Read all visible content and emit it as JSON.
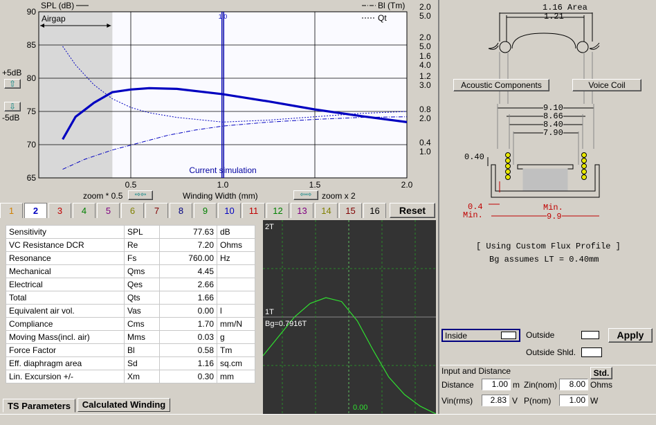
{
  "colors": {
    "accent": "#0000c0",
    "bg": "#d4d0c8",
    "graph_bg": "#333333",
    "green": "#00c000",
    "red": "#c00000"
  },
  "chart_data": {
    "type": "line",
    "title": "",
    "xlabel": "Winding Width (mm)",
    "ylabel": "SPL (dB)",
    "xlim": [
      0.0,
      2.0
    ],
    "ylim": [
      65,
      90
    ],
    "x_ticks": [
      "0.5",
      "1.0",
      "1.5",
      "2.0"
    ],
    "y_ticks": [
      "90",
      "85",
      "80",
      "75",
      "70",
      "65"
    ],
    "right_axis_bl": [
      "2.0",
      "1.6",
      "1.2",
      "0.8",
      "0.4"
    ],
    "right_axis_qt": [
      "5.0",
      "4.0",
      "3.0",
      "2.0",
      "1.0"
    ],
    "legend": {
      "spl": "SPL (dB)",
      "bl": "Bl (Tm)",
      "qt": "Qt"
    },
    "series": [
      {
        "name": "SPL (dB)",
        "x": [
          0.13,
          0.2,
          0.3,
          0.4,
          0.5,
          0.6,
          0.75,
          1.0,
          1.25,
          1.5,
          1.75,
          2.0
        ],
        "y": [
          70.8,
          74.2,
          76.3,
          77.9,
          78.3,
          78.5,
          78.4,
          77.6,
          76.5,
          75.3,
          74.3,
          73.4
        ]
      },
      {
        "name": "Bl (Tm)",
        "x": [
          0.13,
          0.25,
          0.4,
          0.55,
          0.7,
          0.85,
          1.0,
          1.25,
          1.5,
          1.75,
          2.0
        ],
        "y": [
          66.3,
          67.8,
          69.2,
          70.3,
          71.4,
          72.2,
          72.8,
          73.4,
          73.8,
          74.1,
          74.2
        ]
      },
      {
        "name": "Qt",
        "x": [
          0.13,
          0.2,
          0.3,
          0.4,
          0.5,
          0.6,
          0.75,
          1.0,
          1.25,
          1.5,
          1.75,
          2.0
        ],
        "y": [
          84.8,
          82.0,
          79.0,
          76.9,
          75.6,
          74.8,
          74.1,
          73.4,
          73.7,
          74.2,
          74.7,
          75.0
        ]
      }
    ],
    "airgap_x": 0.4,
    "airgap_label": "Airgap",
    "current_x": 1.0,
    "current_label": "Current simulation"
  },
  "zoom": {
    "up_label": "+5dB",
    "down_label": "-5dB",
    "half": "zoom * 0.5",
    "double": "zoom x 2"
  },
  "tabs": [
    "1",
    "2",
    "3",
    "4",
    "5",
    "6",
    "7",
    "8",
    "9",
    "10",
    "11",
    "12",
    "13",
    "14",
    "15",
    "16"
  ],
  "tab_colors": [
    "#d08000",
    "#0000c0",
    "#c00000",
    "#008000",
    "#800080",
    "#808000",
    "#800000",
    "#000080",
    "#008000",
    "#0000c0",
    "#c00000",
    "#008000",
    "#800080",
    "#808000",
    "#800000",
    "#000000"
  ],
  "reset_label": "Reset",
  "ts_rows": [
    [
      "Sensitivity",
      "SPL",
      "77.63",
      "dB"
    ],
    [
      "VC Resistance DCR",
      "Re",
      "7.20",
      "Ohms"
    ],
    [
      "Resonance",
      "Fs",
      "760.00",
      "Hz"
    ],
    [
      "Mechanical",
      "Qms",
      "4.45",
      ""
    ],
    [
      "Electrical",
      "Qes",
      "2.66",
      ""
    ],
    [
      "Total",
      "Qts",
      "1.66",
      ""
    ],
    [
      "Equivalent air vol.",
      "Vas",
      "0.00",
      "l"
    ],
    [
      "Compliance",
      "Cms",
      "1.70",
      "mm/N"
    ],
    [
      "Moving Mass(incl. air)",
      "Mms",
      "0.03",
      "g"
    ],
    [
      "Force Factor",
      "Bl",
      "0.58",
      "Tm"
    ],
    [
      "Eff. diaphragm area",
      "Sd",
      "1.16",
      "sq.cm"
    ],
    [
      "Lin. Excursion +/-",
      "Xm",
      "0.30",
      "mm"
    ]
  ],
  "bottom_tabs": {
    "ts": "TS Parameters",
    "winding": "Calculated Winding"
  },
  "flux": {
    "top_label": "2T",
    "mid_label": "1T",
    "bg_label": "Bg=0.7916T",
    "x_label": "0.00",
    "points": [
      0.3,
      0.4,
      0.5,
      0.57,
      0.6,
      0.58,
      0.48,
      0.33,
      0.19,
      0.1,
      0.04,
      0.0
    ]
  },
  "diagram": {
    "area": "1.16 Area",
    "d_121": "1.21",
    "acoustic_btn": "Acoustic Components",
    "voice_coil_btn": "Voice Coil",
    "d_910": "9.10",
    "d_866": "8.66",
    "d_840": "8.40",
    "d_790": "7.90",
    "d_040": "0.40",
    "min_04": "0.4",
    "min_04b": "Min.",
    "min_top": "Min.",
    "d_99": "9.9",
    "note1": "[ Using Custom Flux Profile ]",
    "note2": "Bg assumes LT =  0.40mm"
  },
  "magnet": {
    "inside": "Inside",
    "outside": "Outside",
    "apply": "Apply",
    "outside_shld": "Outside Shld."
  },
  "input": {
    "title": "Input and Distance",
    "std": "Std.",
    "distance_label": "Distance",
    "distance": "1.00",
    "distance_unit": "m",
    "zin_label": "Zin(nom)",
    "zin": "8.00",
    "zin_unit": "Ohms",
    "vin_label": "Vin(rms)",
    "vin": "2.83",
    "vin_unit": "V",
    "pnom_label": "P(nom)",
    "pnom": "1.00",
    "pnom_unit": "W"
  }
}
